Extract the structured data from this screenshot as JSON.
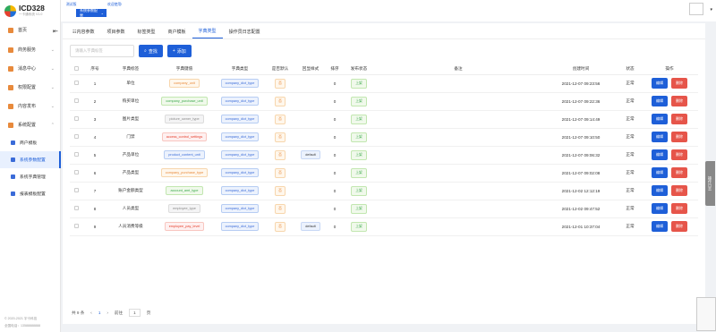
{
  "app": {
    "title": "ICD328",
    "subtitle": "一卡通系统 V1.0"
  },
  "topbar": {
    "tag_test": "测试版",
    "tag_welcome": "欢迎使用!",
    "system_select": "系统参数配置"
  },
  "sidebar": {
    "items": [
      {
        "label": "首页"
      },
      {
        "label": "商务服务"
      },
      {
        "label": "消息中心"
      },
      {
        "label": "权限配置"
      },
      {
        "label": "内容发布"
      },
      {
        "label": "系统配置"
      },
      {
        "label": "商户模板"
      },
      {
        "label": "系统参数配置"
      },
      {
        "label": "系统字典管理"
      },
      {
        "label": "报表模板配置"
      }
    ],
    "footer_copyright": "© 2020-2021 宇卡科技",
    "footer_phone": "全国电话：13588888888"
  },
  "tabs": [
    "内容参数",
    "项目参数",
    "标签类型",
    "商户模板",
    "字典类型",
    "操作员日志配置"
  ],
  "active_tab": 4,
  "search": {
    "placeholder": "请输入字典标签",
    "search_label": "查找",
    "add_label": "添加"
  },
  "table": {
    "headers": [
      "序号",
      "字典标签",
      "字典键值",
      "字典类型",
      "是否默认",
      "回显样式",
      "排序",
      "发布状态",
      "备注",
      "创建时间",
      "状态",
      "操作"
    ],
    "edit_label": "编辑",
    "delete_label": "删除",
    "rows": [
      {
        "no": "1",
        "label": "单位",
        "key": "company_unit",
        "key_style": "orange",
        "type": "company_dict_type",
        "default": "否",
        "echo": "",
        "sort": "0",
        "status": "上架",
        "remark": "",
        "created": "2021-12-07 09:23:56",
        "state": "正常"
      },
      {
        "no": "2",
        "label": "购买单位",
        "key": "company_purchase_unit",
        "key_style": "green",
        "type": "company_dict_type",
        "default": "否",
        "echo": "",
        "sort": "0",
        "status": "上架",
        "remark": "",
        "created": "2021-12-07 09:22:36",
        "state": "正常"
      },
      {
        "no": "3",
        "label": "图片类型",
        "key": "picture_owner_type",
        "key_style": "gray",
        "type": "company_dict_type",
        "default": "否",
        "echo": "",
        "sort": "0",
        "status": "上架",
        "remark": "",
        "created": "2021-12-07 09:14:49",
        "state": "正常"
      },
      {
        "no": "4",
        "label": "门禁",
        "key": "access_control_settings",
        "key_style": "red",
        "type": "company_dict_type",
        "default": "否",
        "echo": "",
        "sort": "0",
        "status": "上架",
        "remark": "",
        "created": "2021-12-07 09:10:50",
        "state": "正常"
      },
      {
        "no": "5",
        "label": "产品单位",
        "key": "product_content_unit",
        "key_style": "blue",
        "type": "company_dict_type",
        "default": "否",
        "echo": "default",
        "sort": "0",
        "status": "上架",
        "remark": "",
        "created": "2021-12-07 09:06:32",
        "state": "正常"
      },
      {
        "no": "6",
        "label": "产品类型",
        "key": "company_purchase_type",
        "key_style": "orange",
        "type": "company_dict_type",
        "default": "否",
        "echo": "",
        "sort": "0",
        "status": "上架",
        "remark": "",
        "created": "2021-12-07 09:02:08",
        "state": "正常"
      },
      {
        "no": "7",
        "label": "账户金额类型",
        "key": "account_amt_type",
        "key_style": "green",
        "type": "company_dict_type",
        "default": "否",
        "echo": "",
        "sort": "0",
        "status": "上架",
        "remark": "",
        "created": "2021-12-02 12:12:19",
        "state": "正常"
      },
      {
        "no": "8",
        "label": "人员类型",
        "key": "employee_type",
        "key_style": "gray",
        "type": "company_dict_type",
        "default": "否",
        "echo": "",
        "sort": "0",
        "status": "上架",
        "remark": "",
        "created": "2021-12-02 09:47:52",
        "state": "正常"
      },
      {
        "no": "9",
        "label": "人员消费等级",
        "key": "employee_pay_level",
        "key_style": "red",
        "type": "company_dict_type",
        "default": "否",
        "echo": "default",
        "sort": "0",
        "status": "上架",
        "remark": "",
        "created": "2021-12-01 10:37:04",
        "state": "正常"
      }
    ]
  },
  "pager": {
    "total": "共 9 条",
    "prev": "‹",
    "page": "1",
    "next": "›",
    "goto": "前往",
    "page_input": "1",
    "suffix": "页"
  },
  "float_panel": "操作日志",
  "colors": {
    "primary": "#1e5fd8",
    "danger": "#e6554a"
  }
}
